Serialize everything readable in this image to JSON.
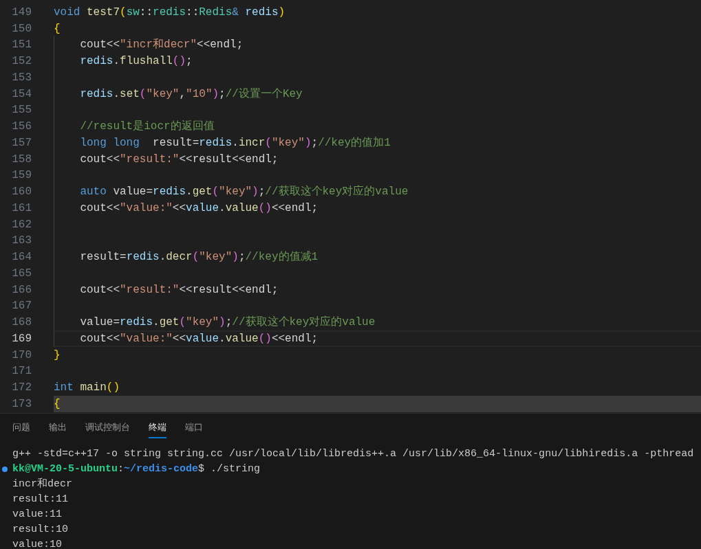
{
  "editor": {
    "lines": [
      {
        "number": "149",
        "tokens": [
          {
            "text": "void ",
            "kind": "keyword"
          },
          {
            "text": "test7",
            "kind": "function"
          },
          {
            "text": "(",
            "kind": "bracket1"
          },
          {
            "text": "sw",
            "kind": "type"
          },
          {
            "text": "::"
          },
          {
            "text": "redis",
            "kind": "type"
          },
          {
            "text": "::"
          },
          {
            "text": "Redis",
            "kind": "type"
          },
          {
            "text": "& ",
            "kind": "keyword"
          },
          {
            "text": "redis",
            "kind": "variable"
          },
          {
            "text": ")",
            "kind": "bracket1"
          }
        ]
      },
      {
        "number": "150",
        "tokens": [
          {
            "text": "{",
            "kind": "bracket1"
          }
        ]
      },
      {
        "number": "151",
        "guide": true,
        "tokens": [
          {
            "text": "    cout<<"
          },
          {
            "text": "\"incr和decr\"",
            "kind": "string"
          },
          {
            "text": "<<endl;"
          }
        ]
      },
      {
        "number": "152",
        "guide": true,
        "tokens": [
          {
            "text": "    redis",
            "kind": "variable"
          },
          {
            "text": "."
          },
          {
            "text": "flushall",
            "kind": "function"
          },
          {
            "text": "()",
            "kind": "bracket2"
          },
          {
            "text": ";"
          }
        ]
      },
      {
        "number": "153",
        "guide": true
      },
      {
        "number": "154",
        "guide": true,
        "tokens": [
          {
            "text": "    redis",
            "kind": "variable"
          },
          {
            "text": "."
          },
          {
            "text": "set",
            "kind": "function"
          },
          {
            "text": "(",
            "kind": "bracket2"
          },
          {
            "text": "\"key\"",
            "kind": "string"
          },
          {
            "text": ","
          },
          {
            "text": "\"10\"",
            "kind": "string"
          },
          {
            "text": ")",
            "kind": "bracket2"
          },
          {
            "text": ";"
          },
          {
            "text": "//设置一个Key",
            "kind": "comment"
          }
        ]
      },
      {
        "number": "155",
        "guide": true
      },
      {
        "number": "156",
        "guide": true,
        "tokens": [
          {
            "text": "    //result是iocr的返回值",
            "kind": "comment"
          }
        ]
      },
      {
        "number": "157",
        "guide": true,
        "tokens": [
          {
            "text": "    long long",
            "kind": "keyword"
          },
          {
            "text": "  result="
          },
          {
            "text": "redis",
            "kind": "variable"
          },
          {
            "text": "."
          },
          {
            "text": "incr",
            "kind": "function"
          },
          {
            "text": "(",
            "kind": "bracket2"
          },
          {
            "text": "\"key\"",
            "kind": "string"
          },
          {
            "text": ")",
            "kind": "bracket2"
          },
          {
            "text": ";"
          },
          {
            "text": "//key的值加1",
            "kind": "comment"
          }
        ]
      },
      {
        "number": "158",
        "guide": true,
        "tokens": [
          {
            "text": "    cout<<"
          },
          {
            "text": "\"result:\"",
            "kind": "string"
          },
          {
            "text": "<<result<<endl;"
          }
        ]
      },
      {
        "number": "159",
        "guide": true
      },
      {
        "number": "160",
        "guide": true,
        "tokens": [
          {
            "text": "    auto",
            "kind": "keyword"
          },
          {
            "text": " value="
          },
          {
            "text": "redis",
            "kind": "variable"
          },
          {
            "text": "."
          },
          {
            "text": "get",
            "kind": "function"
          },
          {
            "text": "(",
            "kind": "bracket2"
          },
          {
            "text": "\"key\"",
            "kind": "string"
          },
          {
            "text": ")",
            "kind": "bracket2"
          },
          {
            "text": ";"
          },
          {
            "text": "//获取这个key对应的value",
            "kind": "comment"
          }
        ]
      },
      {
        "number": "161",
        "guide": true,
        "tokens": [
          {
            "text": "    cout<<"
          },
          {
            "text": "\"value:\"",
            "kind": "string"
          },
          {
            "text": "<<"
          },
          {
            "text": "value",
            "kind": "variable"
          },
          {
            "text": "."
          },
          {
            "text": "value",
            "kind": "function"
          },
          {
            "text": "()",
            "kind": "bracket2"
          },
          {
            "text": "<<endl;"
          }
        ]
      },
      {
        "number": "162",
        "guide": true
      },
      {
        "number": "163",
        "guide": true
      },
      {
        "number": "164",
        "guide": true,
        "tokens": [
          {
            "text": "    result="
          },
          {
            "text": "redis",
            "kind": "variable"
          },
          {
            "text": "."
          },
          {
            "text": "decr",
            "kind": "function"
          },
          {
            "text": "(",
            "kind": "bracket2"
          },
          {
            "text": "\"key\"",
            "kind": "string"
          },
          {
            "text": ")",
            "kind": "bracket2"
          },
          {
            "text": ";"
          },
          {
            "text": "//key的值减1",
            "kind": "comment"
          }
        ]
      },
      {
        "number": "165",
        "guide": true
      },
      {
        "number": "166",
        "guide": true,
        "tokens": [
          {
            "text": "    cout<<"
          },
          {
            "text": "\"result:\"",
            "kind": "string"
          },
          {
            "text": "<<result<<endl;"
          }
        ]
      },
      {
        "number": "167",
        "guide": true
      },
      {
        "number": "168",
        "guide": true,
        "tokens": [
          {
            "text": "    value="
          },
          {
            "text": "redis",
            "kind": "variable"
          },
          {
            "text": "."
          },
          {
            "text": "get",
            "kind": "function"
          },
          {
            "text": "(",
            "kind": "bracket2"
          },
          {
            "text": "\"key\"",
            "kind": "string"
          },
          {
            "text": ")",
            "kind": "bracket2"
          },
          {
            "text": ";"
          },
          {
            "text": "//获取这个key对应的value",
            "kind": "comment"
          }
        ]
      },
      {
        "number": "169",
        "guide": true,
        "current": true,
        "tokens": [
          {
            "text": "    cout<<"
          },
          {
            "text": "\"value:\"",
            "kind": "string"
          },
          {
            "text": "<<"
          },
          {
            "text": "value",
            "kind": "variable"
          },
          {
            "text": "."
          },
          {
            "text": "value",
            "kind": "function"
          },
          {
            "text": "()",
            "kind": "bracket2"
          },
          {
            "text": "<<endl;"
          }
        ]
      },
      {
        "number": "170",
        "tokens": [
          {
            "text": "}",
            "kind": "bracket1"
          }
        ]
      },
      {
        "number": "171"
      },
      {
        "number": "172",
        "tokens": [
          {
            "text": "int",
            "kind": "keyword"
          },
          {
            "text": " main",
            "kind": "function"
          },
          {
            "text": "()",
            "kind": "bracket1"
          }
        ]
      },
      {
        "number": "173",
        "selected": true,
        "tokens": [
          {
            "text": "{",
            "kind": "bracket1"
          }
        ]
      }
    ]
  },
  "panel": {
    "tabs": [
      {
        "label": "问题",
        "selected": false
      },
      {
        "label": "输出",
        "selected": false
      },
      {
        "label": "调试控制台",
        "selected": false
      },
      {
        "label": "终端",
        "selected": true
      },
      {
        "label": "端口",
        "selected": false
      }
    ],
    "terminal": [
      {
        "segments": [
          {
            "text": "g++ -std=c++17 -o string string.cc /usr/local/lib/libredis++.a /usr/lib/x86_64-linux-gnu/libhiredis.a -pthread"
          }
        ]
      },
      {
        "succeeded": true,
        "segments": [
          {
            "text": "kk@VM-20-5-ubuntu",
            "kind": "user"
          },
          {
            "text": ":"
          },
          {
            "text": "~/redis-code",
            "kind": "path"
          },
          {
            "text": "$ ./string"
          }
        ]
      },
      {
        "segments": [
          {
            "text": "incr和decr"
          }
        ]
      },
      {
        "segments": [
          {
            "text": "result:11"
          }
        ]
      },
      {
        "segments": [
          {
            "text": "value:11"
          }
        ]
      },
      {
        "segments": [
          {
            "text": "result:10"
          }
        ]
      },
      {
        "segments": [
          {
            "text": "value:10"
          }
        ]
      }
    ]
  }
}
